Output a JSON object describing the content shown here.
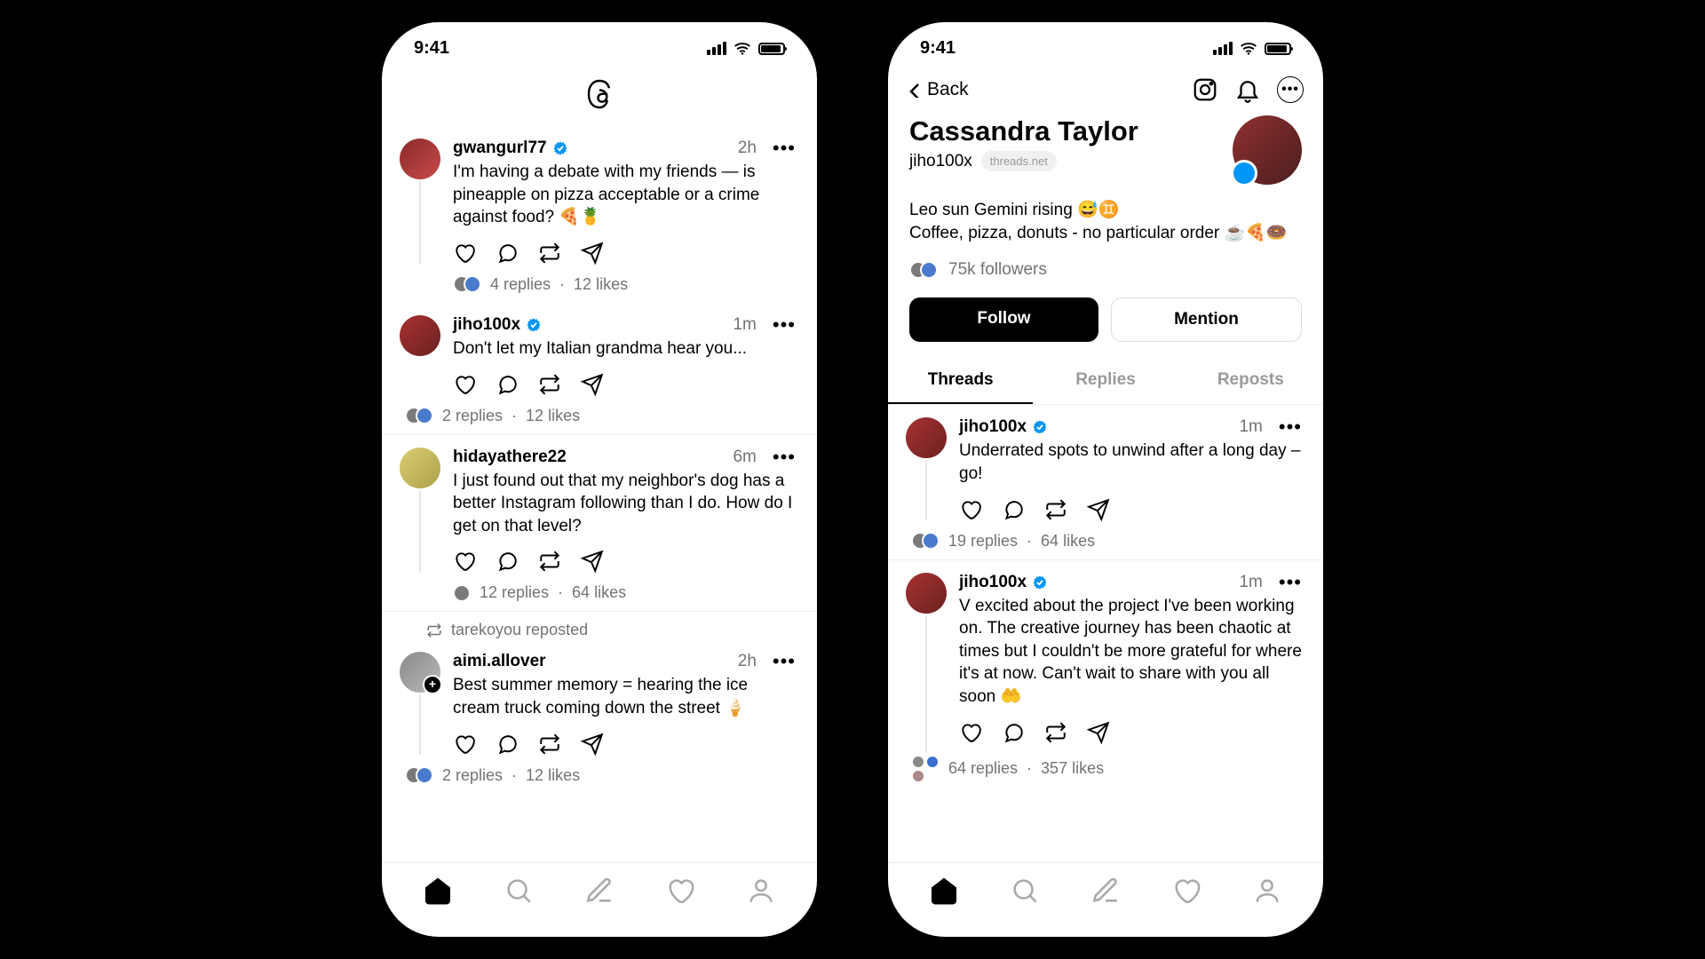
{
  "status": {
    "time": "9:41"
  },
  "feed": {
    "posts": [
      {
        "user": "gwangurl77",
        "verified": true,
        "time": "2h",
        "text": "I'm having a debate with my friends — is pineapple on pizza acceptable or a crime against food? 🍕🍍",
        "replies": "4 replies",
        "likes": "12 likes"
      },
      {
        "user": "jiho100x",
        "verified": true,
        "time": "1m",
        "text": "Don't let my Italian grandma hear you...",
        "replies": "2 replies",
        "likes": "12 likes"
      },
      {
        "user": "hidayathere22",
        "verified": false,
        "time": "6m",
        "text": "I just found out that my neighbor's dog has a better Instagram following than I do. How do I get on that level?",
        "replies": "12 replies",
        "likes": "64 likes"
      },
      {
        "user": "aimi.allover",
        "verified": false,
        "time": "2h",
        "text": "Best summer memory = hearing the ice cream truck coming down the street 🍦",
        "replies": "2 replies",
        "likes": "12 likes",
        "repost_note": "tarekoyou reposted"
      }
    ]
  },
  "profile": {
    "back": "Back",
    "name": "Cassandra Taylor",
    "handle": "jiho100x",
    "domain": "threads.net",
    "bio1": "Leo sun Gemini rising 😅♊",
    "bio2": "Coffee, pizza, donuts - no particular order ☕🍕🍩",
    "followers": "75k followers",
    "follow_btn": "Follow",
    "mention_btn": "Mention",
    "tabs": {
      "threads": "Threads",
      "replies": "Replies",
      "reposts": "Reposts"
    },
    "posts": [
      {
        "user": "jiho100x",
        "verified": true,
        "time": "1m",
        "text": "Underrated spots to unwind after a long day – go!",
        "replies": "19 replies",
        "likes": "64 likes"
      },
      {
        "user": "jiho100x",
        "verified": true,
        "time": "1m",
        "text": "V excited about the project I've been working on. The creative journey has been chaotic at times but I couldn't be more grateful for where it's at now. Can't wait to share with you all soon 🤲",
        "replies": "64 replies",
        "likes": "357 likes"
      }
    ]
  }
}
